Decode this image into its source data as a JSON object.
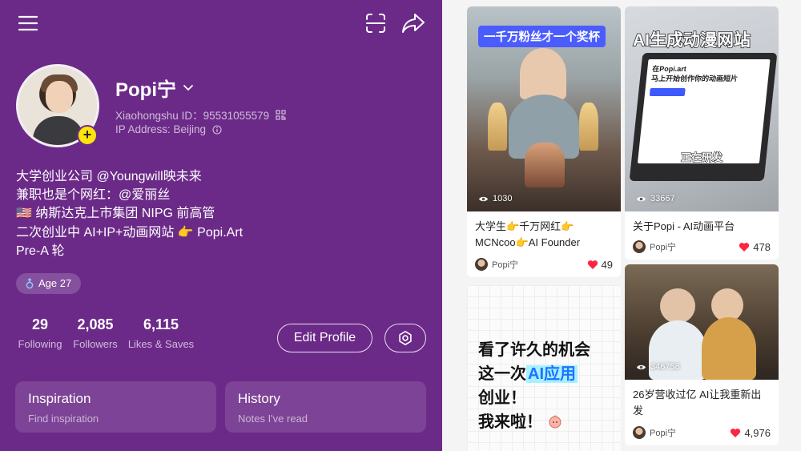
{
  "profile": {
    "name": "Popi宁",
    "id_line": "Xiaohongshu ID：95531055579",
    "ip_line": "IP Address: Beijing",
    "bio": [
      "大学创业公司 @Youngwill映未来",
      "兼职也是个网红：@爱丽丝",
      "🇺🇸 纳斯达克上市集团 NIPG 前高管",
      "二次创业中 AI+IP+动画网站 👉 Popi.Art",
      "Pre-A 轮"
    ],
    "age_chip": "Age 27",
    "stats": [
      {
        "num": "29",
        "label": "Following"
      },
      {
        "num": "2,085",
        "label": "Followers"
      },
      {
        "num": "6,115",
        "label": "Likes & Saves"
      }
    ],
    "edit_button": "Edit Profile",
    "cards": [
      {
        "title": "Inspiration",
        "subtitle": "Find inspiration"
      },
      {
        "title": "History",
        "subtitle": "Notes I've read"
      }
    ]
  },
  "feed": {
    "notes": [
      {
        "banner": "一千万粉丝才一个奖杯",
        "views": "1030",
        "title": "大学生👉千万网红👉MCNcoo👉AI Founder",
        "author": "Popi宁",
        "likes": "49"
      },
      {
        "banner": "AI生成动漫网站",
        "screen_title": "在Popi.art",
        "screen_sub": "马上开始创作你的动画短片",
        "screen_tag": "正在研发",
        "views": "33667",
        "title": "关于Popi - AI动画平台",
        "author": "Popi宁",
        "likes": "478"
      },
      {
        "text_lines": [
          "看了许久的机会",
          "这一次",
          "AI应用",
          "创业！",
          "我来啦！"
        ]
      },
      {
        "views": "346758",
        "title": "26岁营收过亿 AI让我重新出发",
        "author": "Popi宁",
        "likes": "4,976"
      }
    ]
  }
}
